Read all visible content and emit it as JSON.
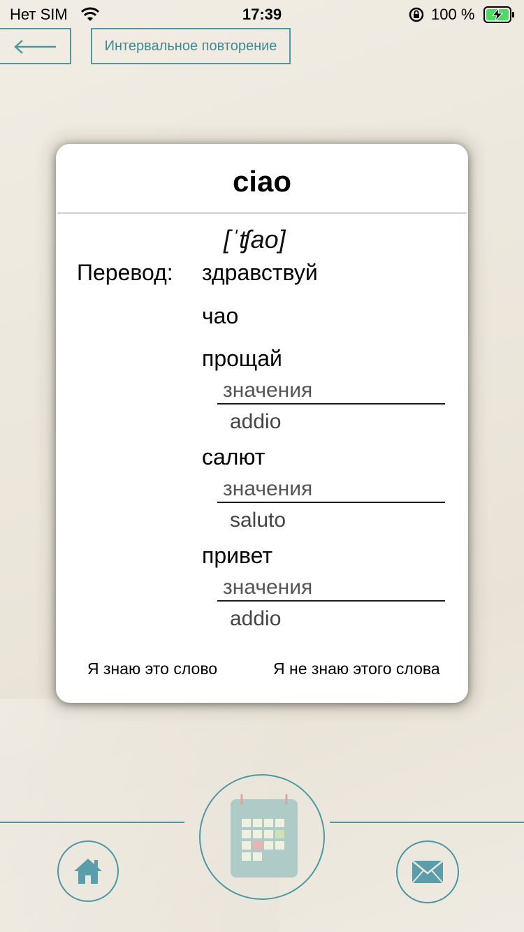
{
  "status_bar": {
    "carrier": "Нет SIM",
    "time": "17:39",
    "battery_percent": "100 %"
  },
  "header": {
    "back_icon": "arrow-left-icon",
    "srs_label": "Интервальное повторение"
  },
  "card": {
    "word": "ciao",
    "transcription": "[ˈʧao]",
    "translation_label": "Перевод:",
    "translations": [
      {
        "word": "здравствуй"
      },
      {
        "word": "чао"
      },
      {
        "word": "прощай",
        "meaning_label": "значения",
        "meaning": "addio"
      },
      {
        "word": "салют",
        "meaning_label": "значения",
        "meaning": "saluto"
      },
      {
        "word": "привет",
        "meaning_label": "значения",
        "meaning": "addio"
      }
    ],
    "know_label": "Я знаю это слово",
    "dont_know_label": "Я не знаю этого слова"
  },
  "bottom_nav": {
    "home_icon": "home-icon",
    "calendar_icon": "calendar-icon",
    "mail_icon": "mail-icon"
  },
  "colors": {
    "accent": "#4c97a2",
    "background": "#ece7dc",
    "card": "#ffffff",
    "icon_fill": "#5a9dab",
    "calendar_body": "#aecbc8"
  }
}
